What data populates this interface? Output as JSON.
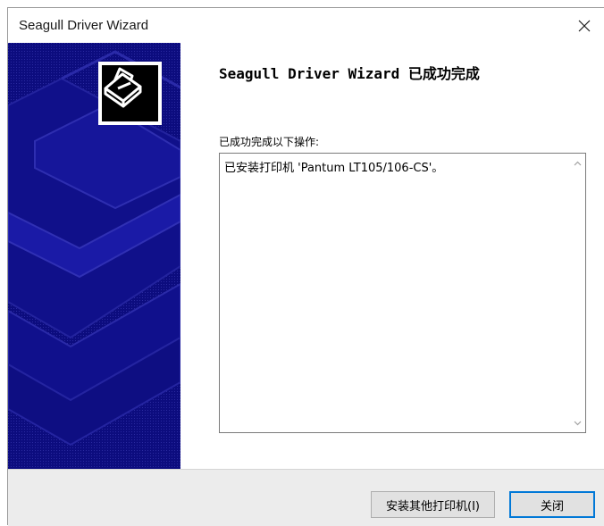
{
  "window": {
    "title": "Seagull Driver Wizard"
  },
  "main": {
    "heading": "Seagull Driver Wizard 已成功完成",
    "operations_label": "已成功完成以下操作:",
    "operations": [
      "已安装打印机 'Pantum LT105/106-CS'。"
    ]
  },
  "buttons": {
    "install_other": "安装其他打印机(I)",
    "close": "关闭"
  },
  "colors": {
    "side_panel": "#0c0c7e",
    "focus_border": "#0078d7"
  }
}
